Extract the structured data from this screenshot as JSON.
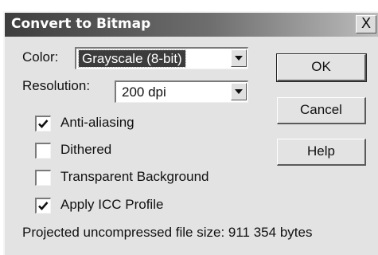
{
  "dialog": {
    "title": "Convert to Bitmap",
    "close_label": "X"
  },
  "color": {
    "label": "Color:",
    "value": "Grayscale (8-bit)"
  },
  "resolution": {
    "label": "Resolution:",
    "value": "200 dpi"
  },
  "options": [
    {
      "label": "Anti-aliasing",
      "checked": true
    },
    {
      "label": "Dithered",
      "checked": false
    },
    {
      "label": "Transparent Background",
      "checked": false
    },
    {
      "label": "Apply ICC Profile",
      "checked": true
    }
  ],
  "buttons": {
    "ok": "OK",
    "cancel": "Cancel",
    "help": "Help"
  },
  "file_size_text": "Projected uncompressed file size: 911 354 bytes"
}
